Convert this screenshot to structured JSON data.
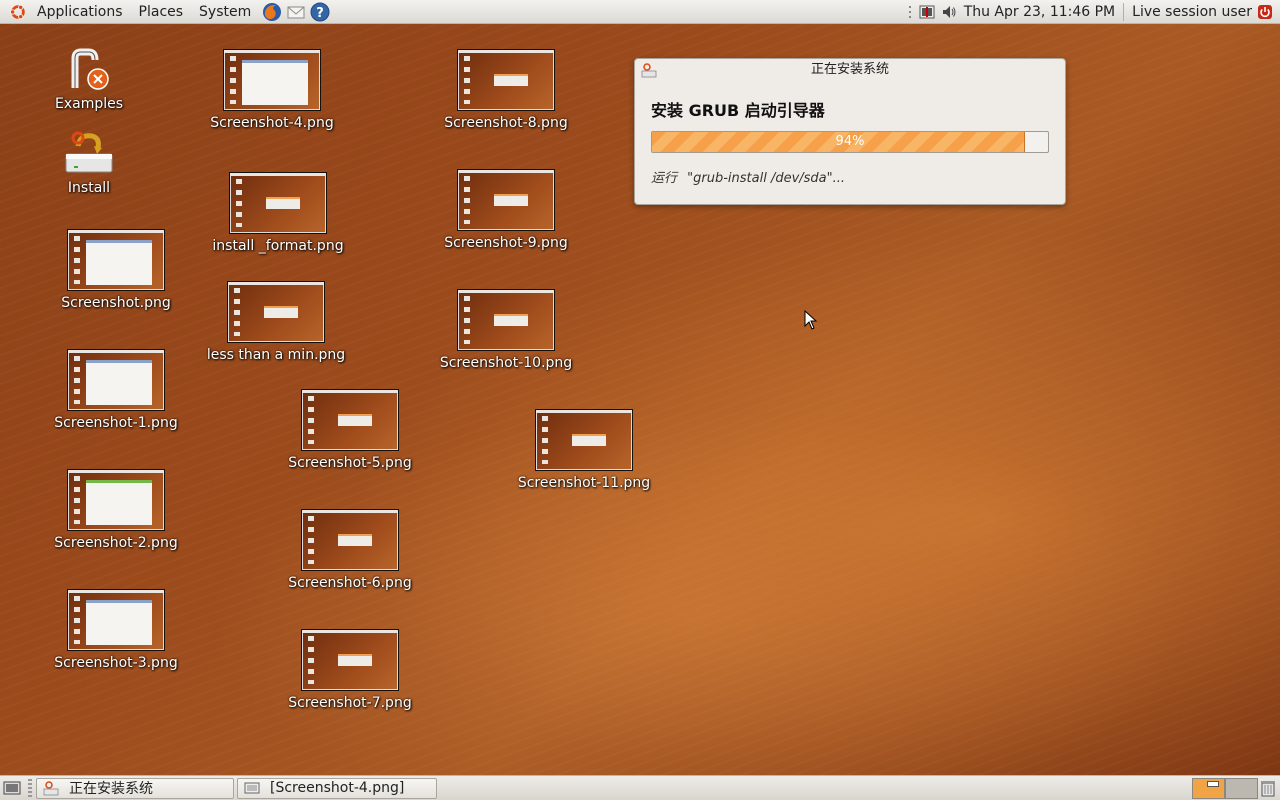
{
  "top_panel": {
    "menus": [
      "Applications",
      "Places",
      "System"
    ],
    "clock": "Thu Apr 23, 11:46 PM",
    "session_user": "Live session user",
    "launchers": [
      "firefox-icon",
      "email-icon",
      "help-icon"
    ],
    "tray": [
      "network-icon",
      "volume-icon"
    ]
  },
  "desktop_icons": {
    "examples": "Examples",
    "install": "Install",
    "files": [
      "Screenshot.png",
      "Screenshot-1.png",
      "Screenshot-2.png",
      "Screenshot-3.png",
      "Screenshot-4.png",
      "install _format.png",
      "less than a min.png",
      "Screenshot-5.png",
      "Screenshot-6.png",
      "Screenshot-7.png",
      "Screenshot-8.png",
      "Screenshot-9.png",
      "Screenshot-10.png",
      "Screenshot-11.png"
    ]
  },
  "dialog": {
    "title": "正在安装系统",
    "heading": "安装  GRUB 启动引导器",
    "progress_text": "94%",
    "progress_value": 0.94,
    "status_prefix": "运行",
    "status_command": "\"grub-install /dev/sda\"..."
  },
  "bottom_panel": {
    "tasks": [
      "正在安装系统",
      "[Screenshot-4.png]"
    ]
  },
  "colors": {
    "accent": "#f6a14a",
    "desktop": "#9b4a1c",
    "panel": "#e6e4df"
  }
}
